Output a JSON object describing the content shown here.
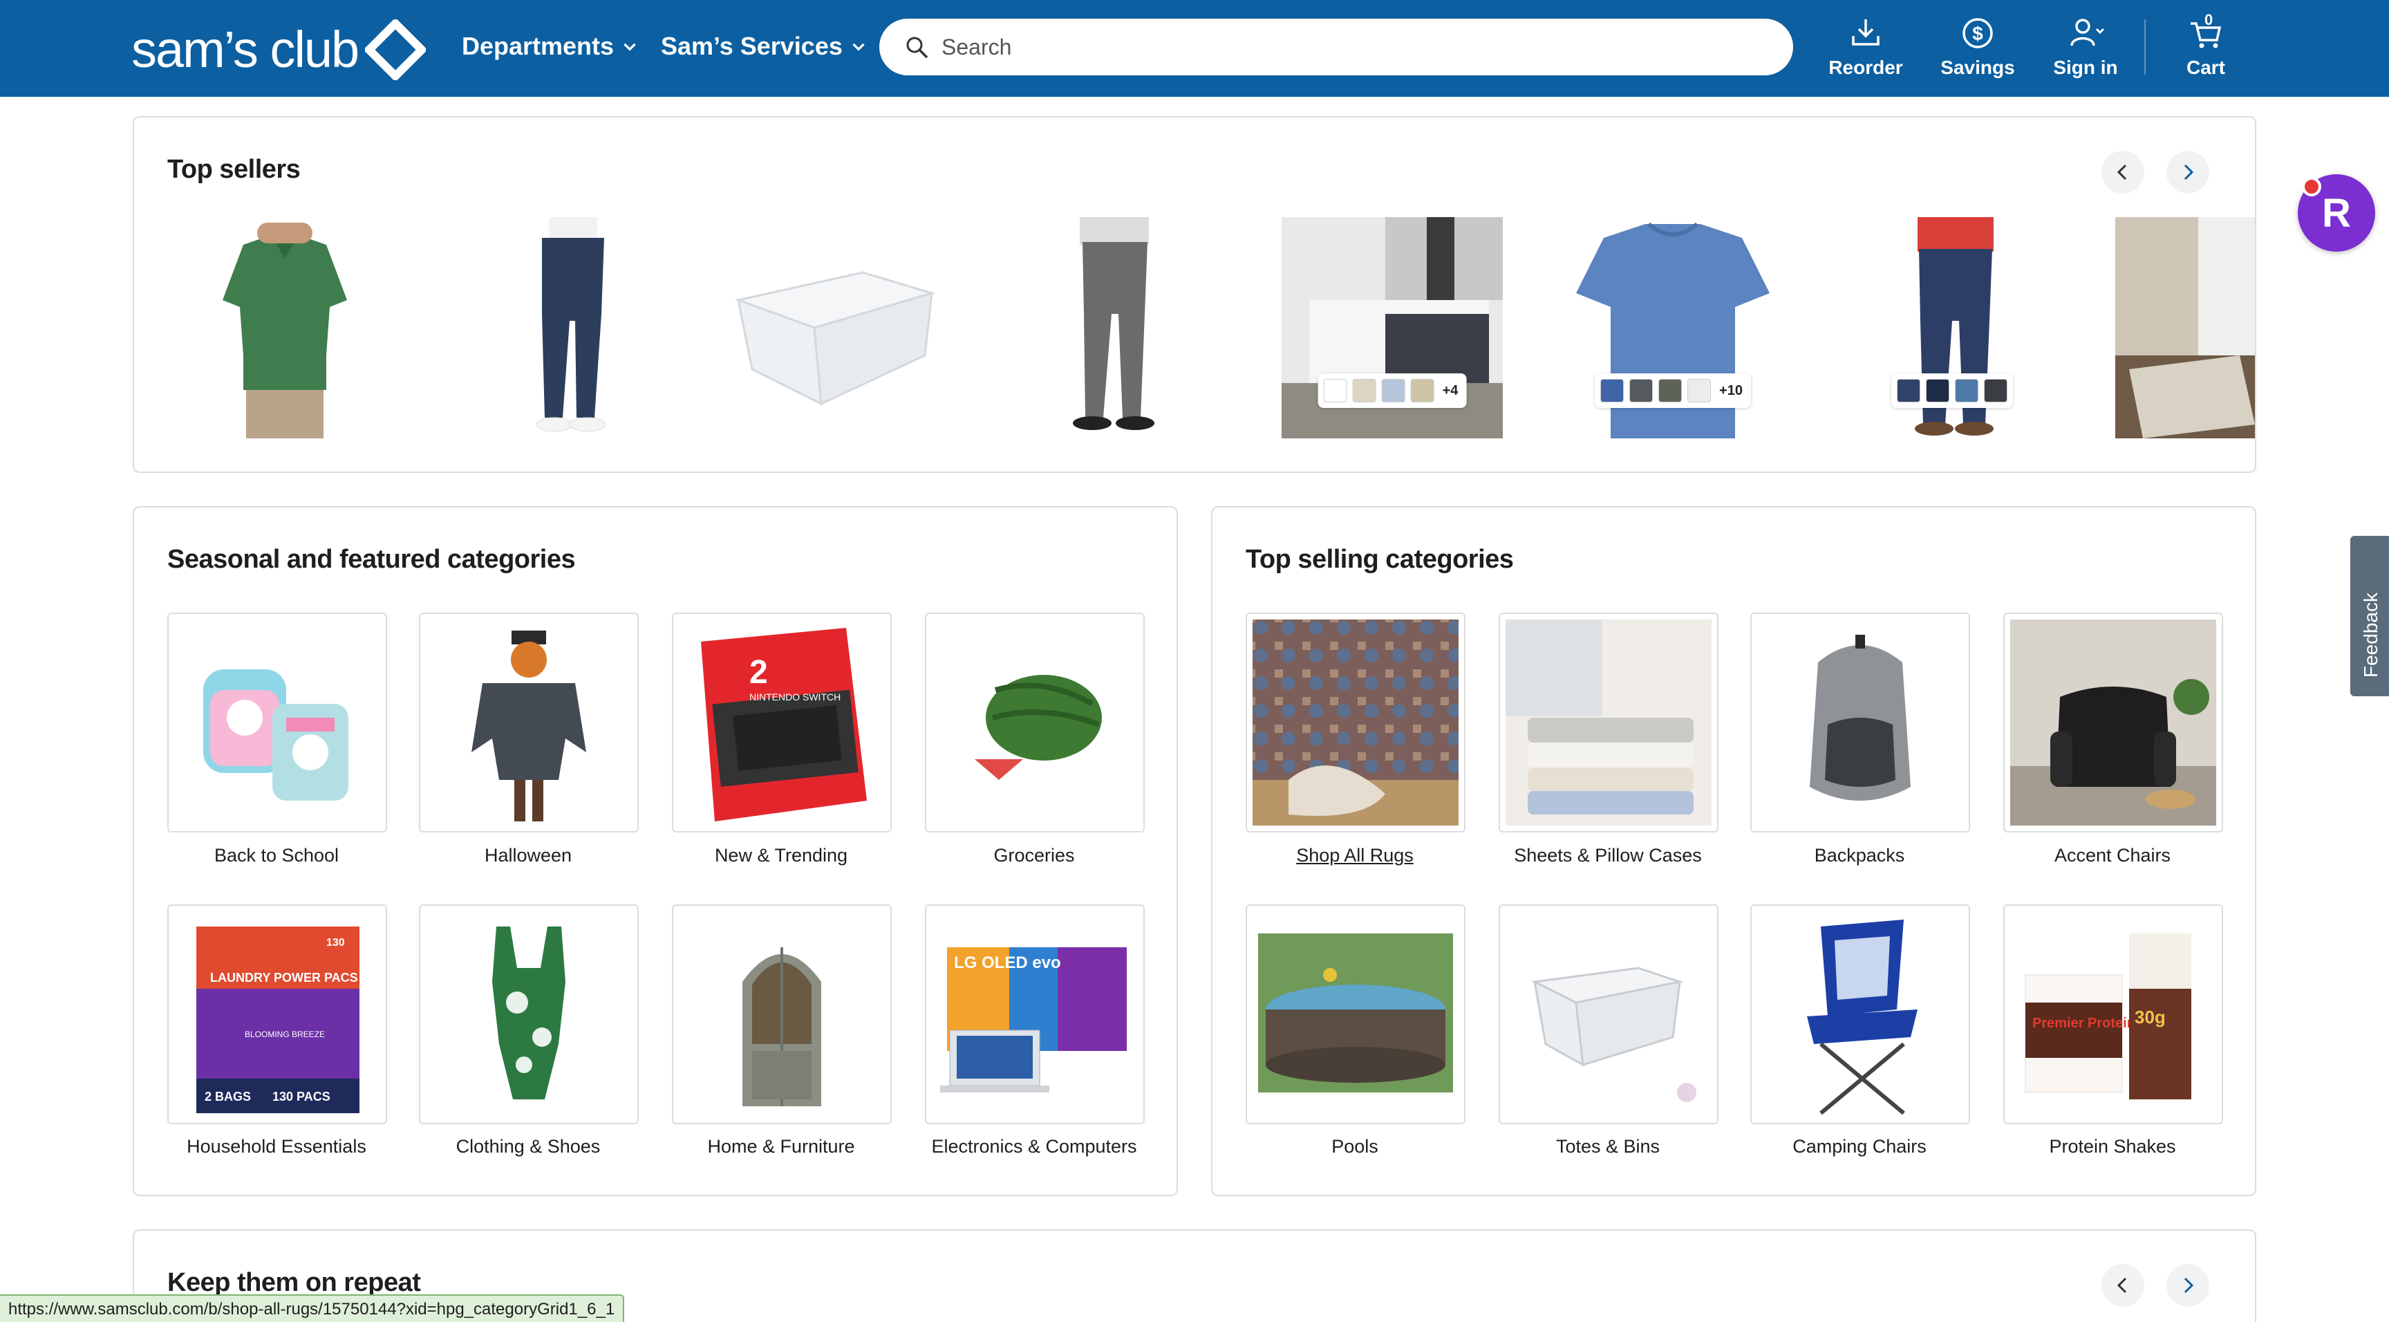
{
  "header": {
    "logo_text": "sam’s club",
    "nav": [
      {
        "label": "Departments"
      },
      {
        "label": "Sam’s Services"
      }
    ],
    "search": {
      "placeholder": "Search"
    },
    "actions": [
      {
        "label": "Reorder",
        "icon": "reorder-icon"
      },
      {
        "label": "Savings",
        "icon": "savings-icon"
      },
      {
        "label": "Sign in",
        "icon": "account-icon"
      },
      {
        "label": "Cart",
        "icon": "cart-icon",
        "count": "0"
      }
    ],
    "brand_color": "#0c5fa0"
  },
  "top_sellers": {
    "title": "Top sellers",
    "products": [
      {
        "name": "green-polo-shirt"
      },
      {
        "name": "navy-joggers"
      },
      {
        "name": "clear-storage-tote"
      },
      {
        "name": "gray-pants"
      },
      {
        "name": "bedding-set",
        "extra_swatches": "+4"
      },
      {
        "name": "blue-tshirt",
        "extra_swatches": "+10"
      },
      {
        "name": "jeans"
      },
      {
        "name": "area-rug"
      }
    ]
  },
  "seasonal": {
    "title": "Seasonal and featured categories",
    "items": [
      {
        "label": "Back to School"
      },
      {
        "label": "Halloween"
      },
      {
        "label": "New & Trending"
      },
      {
        "label": "Groceries"
      },
      {
        "label": "Household Essentials"
      },
      {
        "label": "Clothing & Shoes"
      },
      {
        "label": "Home & Furniture"
      },
      {
        "label": "Electronics & Computers"
      }
    ],
    "image_text": {
      "switch_number": "2",
      "switch_name": "NINTENDO SWITCH",
      "laundry_title": "LAUNDRY POWER PACS",
      "laundry_count": "130",
      "laundry_bags": "2 BAGS",
      "laundry_pacs": "130 PACS",
      "laundry_scent": "BLOOMING BREEZE",
      "tv_brand": "LG OLED evo"
    }
  },
  "top_selling": {
    "title": "Top selling categories",
    "items": [
      {
        "label": "Shop All Rugs"
      },
      {
        "label": "Sheets & Pillow Cases"
      },
      {
        "label": "Backpacks"
      },
      {
        "label": "Accent Chairs"
      },
      {
        "label": "Pools"
      },
      {
        "label": "Totes & Bins"
      },
      {
        "label": "Camping Chairs"
      },
      {
        "label": "Protein Shakes"
      }
    ],
    "image_text": {
      "protein_brand": "Premier Protein",
      "protein_grams": "30g"
    }
  },
  "repeat": {
    "title": "Keep them on repeat"
  },
  "widgets": {
    "assistant_letter": "R",
    "feedback_label": "Feedback"
  },
  "status_bar": {
    "url": "https://www.samsclub.com/b/shop-all-rugs/15750144?xid=hpg_categoryGrid1_6_1"
  }
}
